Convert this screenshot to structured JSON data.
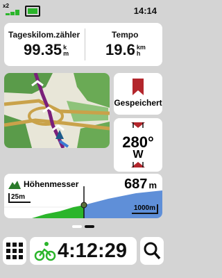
{
  "status": {
    "battery_multiplier": "x2",
    "time": "14:14"
  },
  "trip": {
    "odometer_label": "Tageskilom.zähler",
    "odometer_value": "99.35",
    "odometer_unit_top": "k",
    "odometer_unit_bottom": "m",
    "speed_label": "Tempo",
    "speed_value": "19.6",
    "speed_unit_top": "km",
    "speed_unit_bottom": "h"
  },
  "saved": {
    "label": "Gespeichert"
  },
  "compass": {
    "heading_value": "280°",
    "direction": "W"
  },
  "altitude": {
    "label": "Höhenmesser",
    "value": "687",
    "unit": "m",
    "vertical_scale": "25m",
    "horizontal_scale": "1000m"
  },
  "pager": {
    "pages": 2,
    "active": 1
  },
  "bottom": {
    "timer": "4:12:29"
  },
  "colors": {
    "accent_red": "#b3262c",
    "route": "#7a1f7a",
    "map_green": "#5a9b4a"
  }
}
